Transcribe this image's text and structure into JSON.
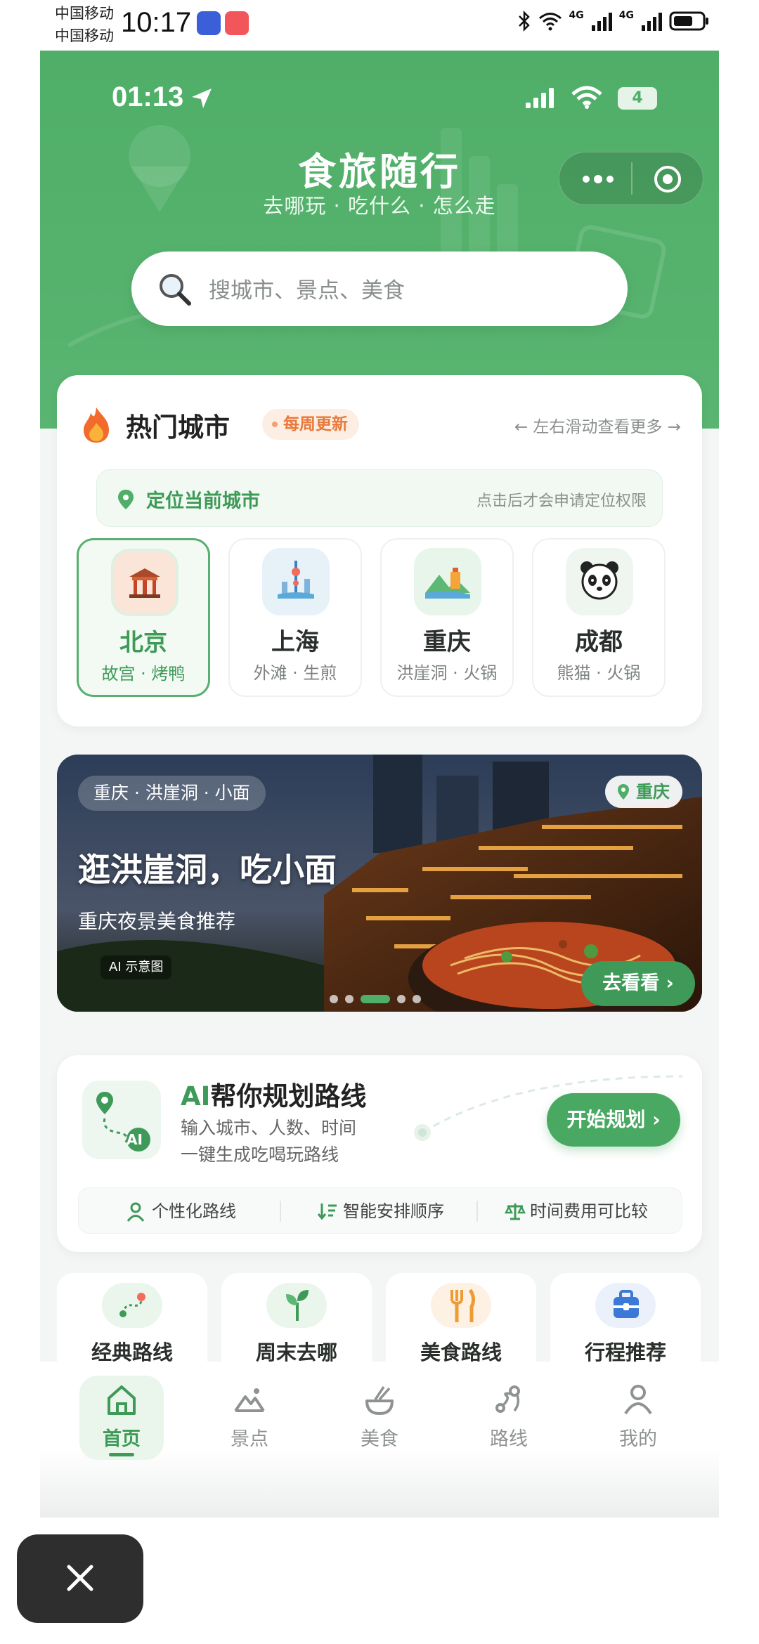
{
  "host_status": {
    "carrier1": "中国移动",
    "carrier2": "中国移动",
    "time": "10:17",
    "net1": "4G",
    "net2": "4G"
  },
  "inner_status": {
    "time": "01:13",
    "battery": "4"
  },
  "header": {
    "title": "食旅随行",
    "subtitle": "去哪玩 · 吃什么 · 怎么走"
  },
  "search": {
    "placeholder": "搜城市、景点、美食"
  },
  "hot_cities": {
    "title": "热门城市",
    "badge": "每周更新",
    "hint": "← 左右滑动查看更多 →",
    "locate_label": "定位当前城市",
    "locate_hint": "点击后才会申请定位权限",
    "cities": [
      {
        "name": "北京",
        "tags": "故宫 · 烤鸭",
        "icon": "palace-icon"
      },
      {
        "name": "上海",
        "tags": "外滩 · 生煎",
        "icon": "tower-icon"
      },
      {
        "name": "重庆",
        "tags": "洪崖洞 · 火锅",
        "icon": "mountain-building-icon"
      },
      {
        "name": "成都",
        "tags": "熊猫 · 火锅",
        "icon": "panda-icon"
      }
    ]
  },
  "banner": {
    "chip": "重庆 · 洪崖洞 · 小面",
    "city": "重庆",
    "title": "逛洪崖洞，吃小面",
    "subtitle": "重庆夜景美食推荐",
    "ai_mark": "AI 示意图",
    "button": "去看看 ›",
    "page_count": 5,
    "active_page": 3
  },
  "ai_plan": {
    "title_ai": "AI",
    "title_rest": "帮你规划路线",
    "desc1": "输入城市、人数、时间",
    "desc2": "一键生成吃喝玩路线",
    "button": "开始规划 ›",
    "badge": "AI",
    "features": [
      "个性化路线",
      "智能安排顺序",
      "时间费用可比较"
    ]
  },
  "quick_entries": [
    {
      "label": "经典路线",
      "icon": "route-icon"
    },
    {
      "label": "周末去哪",
      "icon": "sprout-icon"
    },
    {
      "label": "美食路线",
      "icon": "fork-knife-icon"
    },
    {
      "label": "行程推荐",
      "icon": "suitcase-icon"
    }
  ],
  "tabbar": [
    {
      "label": "首页",
      "icon": "home-icon",
      "active": true
    },
    {
      "label": "景点",
      "icon": "mountain-icon",
      "active": false
    },
    {
      "label": "美食",
      "icon": "bowl-icon",
      "active": false
    },
    {
      "label": "路线",
      "icon": "route-icon",
      "active": false
    },
    {
      "label": "我的",
      "icon": "user-icon",
      "active": false
    }
  ],
  "colors": {
    "brand_green": "#4fae67",
    "accent_orange": "#e8793c"
  }
}
